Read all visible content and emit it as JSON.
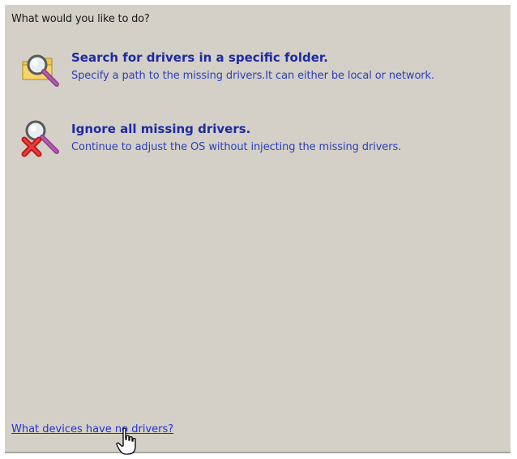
{
  "prompt": "What would you like to do?",
  "options": [
    {
      "title": "Search for drivers in a specific folder.",
      "description": "Specify a path to the missing drivers.It can either be local or network.",
      "icon": "folder-search-icon"
    },
    {
      "title": "Ignore all missing drivers.",
      "description": "Continue to adjust the OS without injecting the missing drivers.",
      "icon": "search-cancel-icon"
    }
  ],
  "help_link": "What devices have no drivers?",
  "colors": {
    "panel_bg": "#d4d0c8",
    "option_title": "#1d2aa0",
    "option_desc": "#2c3fb8",
    "link": "#2233cc"
  }
}
